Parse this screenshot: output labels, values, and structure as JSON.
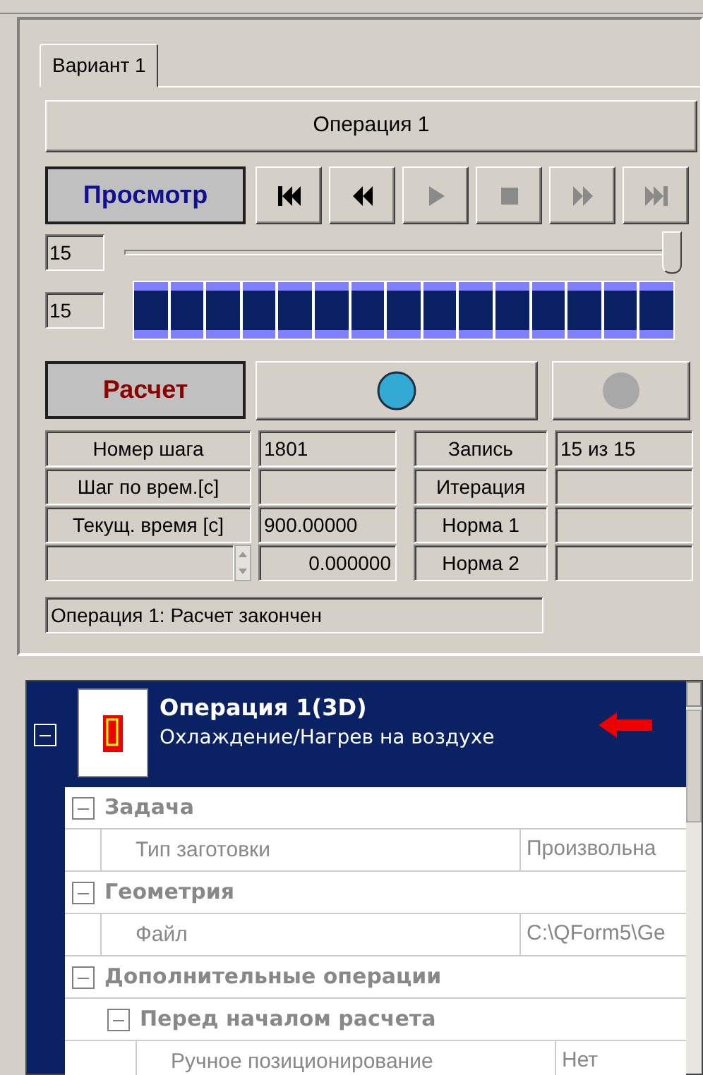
{
  "tabs": [
    {
      "label": "Вариант 1",
      "selected": true
    }
  ],
  "operation_button": "Операция 1",
  "view_button": "Просмотр",
  "media_buttons": [
    {
      "kind": "first",
      "disabled": false
    },
    {
      "kind": "back",
      "disabled": false
    },
    {
      "kind": "play",
      "disabled": true
    },
    {
      "kind": "stop",
      "disabled": true
    },
    {
      "kind": "forward",
      "disabled": true
    },
    {
      "kind": "last",
      "disabled": true
    }
  ],
  "step_slider": {
    "value": "15",
    "level": 1
  },
  "progress": {
    "value": "15",
    "level": 1
  },
  "calc_button": "Расчет",
  "indicators": [
    {
      "color": "#33aad4",
      "disabled": false
    },
    {
      "color": "#a8a8a8",
      "disabled": true
    }
  ],
  "info_rows": [
    {
      "kind": "label",
      "label": "Номер шага",
      "value": "1801",
      "label2": "Запись",
      "value2": "15 из 15"
    },
    {
      "kind": "label",
      "label": "Шаг по врем.[с]",
      "label2": "Итерация"
    },
    {
      "kind": "label",
      "label": "Текущ. время [с]",
      "value": "900.00000",
      "label2": "Норма 1"
    },
    {
      "kind": "spinner",
      "value": "0.000000",
      "label2": "Норма 2"
    }
  ],
  "status": "Операция 1: Расчет закончен",
  "property_grid": {
    "title": "Операция 1(3D)",
    "subtitle": "Охлаждение/Нагрев на воздухе",
    "expanded": true,
    "items": [
      {
        "kind": "category",
        "name": "Задача",
        "expanded": true,
        "children": [
          {
            "kind": "property",
            "name": "Тип заготовки",
            "value": "Произвольна"
          }
        ]
      },
      {
        "kind": "category",
        "name": "Геометрия",
        "expanded": true,
        "children": [
          {
            "kind": "property",
            "name": "Файл",
            "value": "C:\\QForm5\\Ge"
          }
        ]
      },
      {
        "kind": "category",
        "name": "Дополнительные операции",
        "expanded": true,
        "children": [
          {
            "kind": "category",
            "name": "Перед началом расчета",
            "expanded": true,
            "children": [
              {
                "kind": "property",
                "name": "Ручное позиционирование",
                "value": "Нет"
              }
            ]
          }
        ]
      }
    ]
  }
}
